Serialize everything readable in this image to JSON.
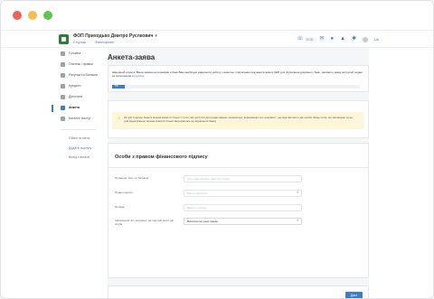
{
  "window": {
    "dots": [
      "#f06157",
      "#f4be4f",
      "#5fc454"
    ]
  },
  "header": {
    "company_name": "ФОП Приходько Дмитро Руслкович",
    "caret": "▾",
    "link_pages": "Сторінки",
    "link_accounts": "Фізосторінки",
    "phone": "0700",
    "lang": "UA",
    "accent": "#3d7cc9",
    "logo_color": "#2e7d32"
  },
  "sidebar": {
    "items": [
      {
        "label": "Головна"
      },
      {
        "label": "Платежі і правки"
      },
      {
        "label": "Рахунки та Виписки"
      },
      {
        "label": "Кредити"
      },
      {
        "label": "Депозити"
      },
      {
        "label": "Анкета",
        "active": true
      },
      {
        "label": "Каталог послуг"
      }
    ],
    "extra": [
      {
        "label": "Обмін та мета"
      },
      {
        "label": "Додати послугу"
      },
      {
        "label": "Вихід з анкети"
      }
    ]
  },
  "main": {
    "title": "Анкета-заява",
    "info": {
      "text": "Шановний клієнте! Ваша заявка на перевірки в банк Вам необхідно завершити роботу з анкетою і підписання документів ваших КЕП для підписання документу банк, заповніть заяву інструкції подані за посиланням ",
      "link": "Інструкція",
      "progress_percent": "5%"
    },
    "warning": {
      "icon": "⚠",
      "text": "За цієї сторінці Анкета можна змінити тільки ті поля, які доступні для редагування, наприклад: 'Інформація про документ', на підставі якого діє особа. Якщо поля, які заповнено та не для редагування, можна змінити тільки звернувшись до відділення банку"
    },
    "section_title": "Особи з правом фінансового підпису",
    "fields": [
      {
        "label": "Прізвище, ім'я, по батькові",
        "value": "Але щодо вказати дані про особи"
      },
      {
        "label": "Право підпису",
        "value": "Рівне підписати"
      },
      {
        "label": "Посада",
        "value": "Введіть посаду"
      },
      {
        "label": "Інформація про документ, на підставі якого діє особа",
        "value": "Виписка про реєстрацію"
      }
    ],
    "submit_label": "Далі"
  }
}
